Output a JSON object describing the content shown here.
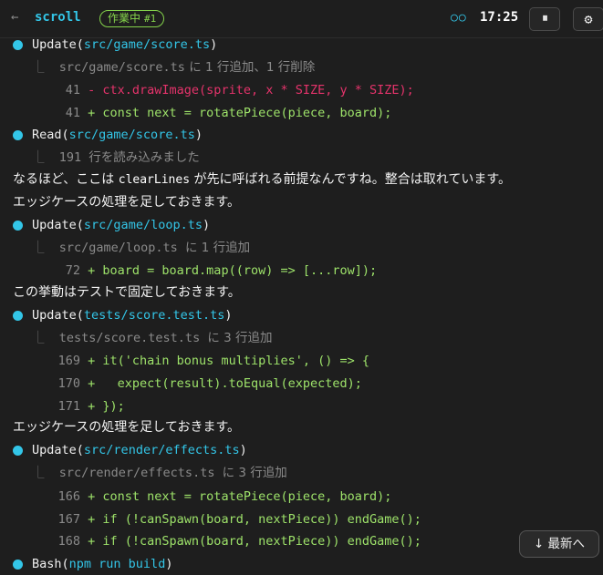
{
  "header": {
    "back_icon": "←",
    "title": "scroll",
    "badge_label": "作業中",
    "badge_count": "#1",
    "status_dots": "○○",
    "time": "17:25",
    "pause_icon": "⏸",
    "settings_icon": "⚙"
  },
  "log": {
    "e1_tool": "Update",
    "e1_path": "src/game/score.ts",
    "e1_sum_path": "src/game/score.ts",
    "e1_sum_text": "に 1 行追加、1 行削除",
    "e1_l1_no": "41",
    "e1_l1_code": "- ctx.drawImage(sprite, x * SIZE, y * SIZE);",
    "e1_l2_no": "41",
    "e1_l2_code": "+ const next = rotatePiece(piece, board);",
    "e2_tool": "Read",
    "e2_path": "src/game/score.ts",
    "e2_sum_no": "191",
    "e2_sum_text": "行を読み込みました",
    "p1_a": "なるほど、ここは ",
    "p1_code": "clearLines",
    "p1_b": " が先に呼ばれる前提なんですね。整合は取れています。",
    "p2": "エッジケースの処理を足しておきます。",
    "e3_tool": "Update",
    "e3_path": "src/game/loop.ts",
    "e3_sum_path": "src/game/loop.ts",
    "e3_sum_text": "に 1 行追加",
    "e3_l1_no": "72",
    "e3_l1_code": "+ board = board.map((row) => [...row]);",
    "p3": "この挙動はテストで固定しておきます。",
    "e4_tool": "Update",
    "e4_path": "tests/score.test.ts",
    "e4_sum_path": "tests/score.test.ts",
    "e4_sum_text": "に 3 行追加",
    "e4_l1_no": "169",
    "e4_l1_code": "+ it('chain bonus multiplies', () => {",
    "e4_l2_no": "170",
    "e4_l2_code": "+   expect(result).toEqual(expected);",
    "e4_l3_no": "171",
    "e4_l3_code": "+ });",
    "p4": "エッジケースの処理を足しておきます。",
    "e5_tool": "Update",
    "e5_path": "src/render/effects.ts",
    "e5_sum_path": "src/render/effects.ts",
    "e5_sum_text": "に 3 行追加",
    "e5_l1_no": "166",
    "e5_l1_code": "+ const next = rotatePiece(piece, board);",
    "e5_l2_no": "167",
    "e5_l2_code": "+ if (!canSpawn(board, nextPiece)) endGame();",
    "e5_l3_no": "168",
    "e5_l3_code": "+ if (!canSpawn(board, nextPiece)) endGame();",
    "e6_tool": "Bash",
    "e6_path": "npm run build"
  },
  "jump_latest": "↓ 最新へ",
  "colors": {
    "accent": "#33c6e8",
    "added": "#9ee36a",
    "removed": "#e5336b",
    "badge": "#84d34b"
  }
}
